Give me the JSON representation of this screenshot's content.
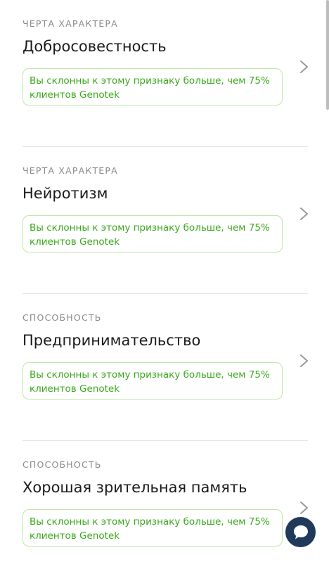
{
  "cards": [
    {
      "category": "ЧЕРТА ХАРАКТЕРА",
      "title": "Добросовестность",
      "badge": "Вы склонны к этому признаку больше, чем 75% клиентов Genotek"
    },
    {
      "category": "ЧЕРТА ХАРАКТЕРА",
      "title": "Нейротизм",
      "badge": "Вы склонны к этому признаку больше, чем 75% клиентов Genotek"
    },
    {
      "category": "СПОСОБНОСТЬ",
      "title": "Предпринимательство",
      "badge": "Вы склонны к этому признаку больше, чем 75% клиентов Genotek"
    },
    {
      "category": "СПОСОБНОСТЬ",
      "title": "Хорошая зрительная память",
      "badge": "Вы склонны к этому признаку больше, чем 75% клиентов Genotek"
    }
  ],
  "colors": {
    "accent_green": "#3aa81c",
    "badge_border": "#bfe7a9",
    "chat_button": "#1f3a5a"
  },
  "icons": {
    "card_arrow": "chevron-right-icon",
    "chat": "chat-bubble-icon"
  }
}
